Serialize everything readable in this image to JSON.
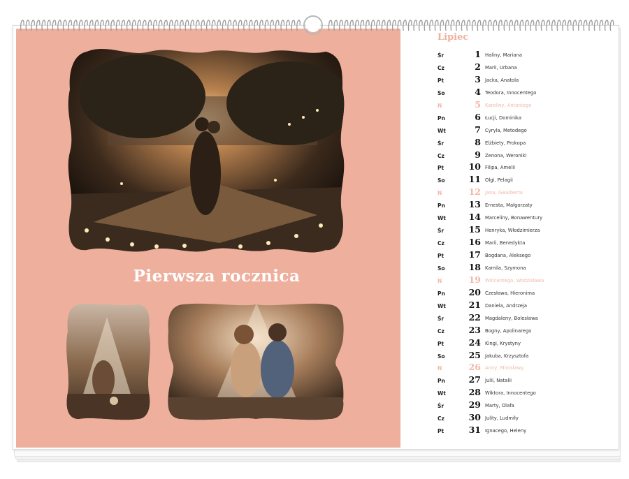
{
  "calendar": {
    "title": "Pierwsza rocznica",
    "month": "Lipiec",
    "accent_color": "#eeaf9d",
    "days": [
      {
        "wd": "Śr",
        "num": "1",
        "names": "Haliny, Mariana",
        "sunday": false
      },
      {
        "wd": "Cz",
        "num": "2",
        "names": "Marii, Urbana",
        "sunday": false
      },
      {
        "wd": "Pt",
        "num": "3",
        "names": "Jacka, Anatola",
        "sunday": false
      },
      {
        "wd": "So",
        "num": "4",
        "names": "Teodora, Innocentego",
        "sunday": false
      },
      {
        "wd": "N",
        "num": "5",
        "names": "Karoliny, Antoniego",
        "sunday": true
      },
      {
        "wd": "Pn",
        "num": "6",
        "names": "Łucji, Dominika",
        "sunday": false
      },
      {
        "wd": "Wt",
        "num": "7",
        "names": "Cyryla, Metodego",
        "sunday": false
      },
      {
        "wd": "Śr",
        "num": "8",
        "names": "Elżbiety, Prokopa",
        "sunday": false
      },
      {
        "wd": "Cz",
        "num": "9",
        "names": "Zenona, Weroniki",
        "sunday": false
      },
      {
        "wd": "Pt",
        "num": "10",
        "names": "Filipa, Amelii",
        "sunday": false
      },
      {
        "wd": "So",
        "num": "11",
        "names": "Olgi, Pelagii",
        "sunday": false
      },
      {
        "wd": "N",
        "num": "12",
        "names": "Jana, Gwalberta",
        "sunday": true
      },
      {
        "wd": "Pn",
        "num": "13",
        "names": "Ernesta, Małgorzaty",
        "sunday": false
      },
      {
        "wd": "Wt",
        "num": "14",
        "names": "Marceliny, Bonawentury",
        "sunday": false
      },
      {
        "wd": "Śr",
        "num": "15",
        "names": "Henryka, Włodzimierza",
        "sunday": false
      },
      {
        "wd": "Cz",
        "num": "16",
        "names": "Marii, Benedykta",
        "sunday": false
      },
      {
        "wd": "Pt",
        "num": "17",
        "names": "Bogdana, Aleksego",
        "sunday": false
      },
      {
        "wd": "So",
        "num": "18",
        "names": "Kamila, Szymona",
        "sunday": false
      },
      {
        "wd": "N",
        "num": "19",
        "names": "Wincentego, Wodzisława",
        "sunday": true
      },
      {
        "wd": "Pn",
        "num": "20",
        "names": "Czesława, Hieronima",
        "sunday": false
      },
      {
        "wd": "Wt",
        "num": "21",
        "names": "Daniela, Andrzeja",
        "sunday": false
      },
      {
        "wd": "Śr",
        "num": "22",
        "names": "Magdaleny, Bolesława",
        "sunday": false
      },
      {
        "wd": "Cz",
        "num": "23",
        "names": "Bogny, Apolinarego",
        "sunday": false
      },
      {
        "wd": "Pt",
        "num": "24",
        "names": "Kingi, Krystyny",
        "sunday": false
      },
      {
        "wd": "So",
        "num": "25",
        "names": "Jakuba, Krzysztofa",
        "sunday": false
      },
      {
        "wd": "N",
        "num": "26",
        "names": "Anny, Mirosławy",
        "sunday": true
      },
      {
        "wd": "Pn",
        "num": "27",
        "names": "Julii, Natalii",
        "sunday": false
      },
      {
        "wd": "Wt",
        "num": "28",
        "names": "Wiktora, Innocentego",
        "sunday": false
      },
      {
        "wd": "Śr",
        "num": "29",
        "names": "Marty, Olafa",
        "sunday": false
      },
      {
        "wd": "Cz",
        "num": "30",
        "names": "Julity, Ludmiły",
        "sunday": false
      },
      {
        "wd": "Pt",
        "num": "31",
        "names": "Ignacego, Heleny",
        "sunday": false
      }
    ]
  }
}
